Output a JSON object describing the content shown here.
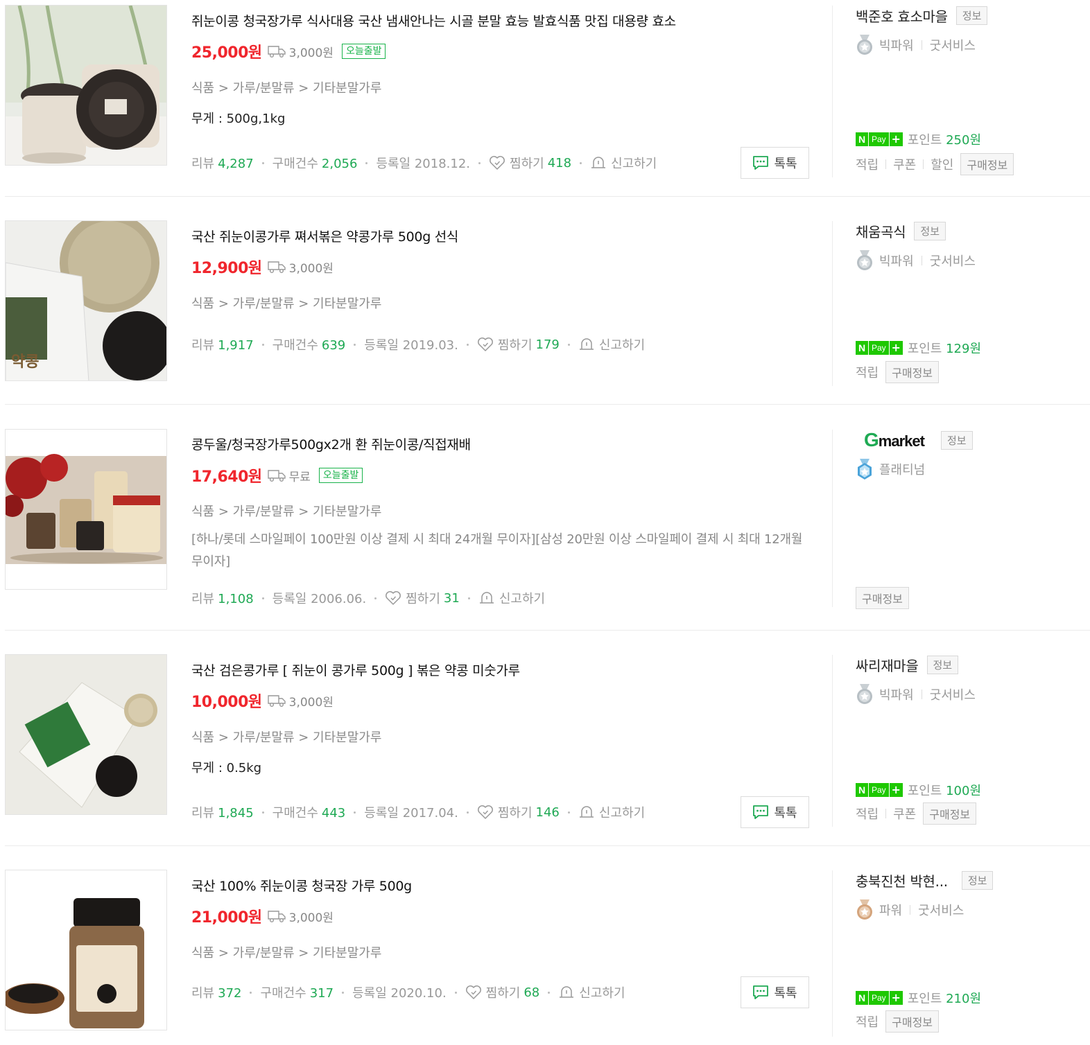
{
  "icons": {
    "truck": "truck-icon",
    "heart": "heart-icon",
    "bell": "report-bell-icon",
    "talk": "talk-bubble-icon",
    "medal": "grade-medal-icon"
  },
  "colors": {
    "price": "#f0262d",
    "accent_green": "#1fa954",
    "npay_green": "#1ec800",
    "badge_green": "#19b34a"
  },
  "labels": {
    "review": "리뷰",
    "purchase": "구매건수",
    "registered": "등록일",
    "wish": "찜하기",
    "report": "신고하기",
    "talk": "톡톡",
    "info": "정보",
    "point": "포인트",
    "buy_info": "구매정보",
    "npay_n": "N",
    "npay_pay": "Pay",
    "npay_plus": "+"
  },
  "products": [
    {
      "title": "쥐눈이콩 청국장가루 식사대용 국산 냄새안나는 시골 분말 효능 발효식품 맛집 대용량 효소",
      "price": "25,000원",
      "shipping": "3,000원",
      "badge": "오늘출발",
      "category": "식품 > 가루/분말류 > 기타분말가루",
      "spec": "무게 : 500g,1kg",
      "review": "4,287",
      "purchase": "2,056",
      "registered": "2018.12.",
      "wish": "418",
      "seller": "백준호 효소마을",
      "grade": "빅파워",
      "service": "굿서비스",
      "point_amount": "250원",
      "benefits": [
        "적립",
        "쿠폰",
        "할인"
      ]
    },
    {
      "title": "국산 쥐눈이콩가루 쪄서볶은 약콩가루 500g 선식",
      "price": "12,900원",
      "shipping": "3,000원",
      "category": "식품 > 가루/분말류 > 기타분말가루",
      "review": "1,917",
      "purchase": "639",
      "registered": "2019.03.",
      "wish": "179",
      "seller": "채움곡식",
      "grade": "빅파워",
      "service": "굿서비스",
      "point_amount": "129원",
      "benefits": [
        "적립"
      ]
    },
    {
      "title": "콩두울/청국장가루500gx2개 환 쥐눈이콩/직접재배",
      "price": "17,640원",
      "shipping": "무료",
      "badge": "오늘출발",
      "category": "식품 > 가루/분말류 > 기타분말가루",
      "desc": "[하나/롯데 스마일페이 100만원 이상 결제 시 최대 24개월 무이자][삼성 20만원 이상 스마일페이 결제 시 최대 12개월 무이자]",
      "review": "1,108",
      "registered": "2006.06.",
      "wish": "31",
      "seller_logo_g": "G",
      "seller_logo_rest": "market",
      "grade": "플래티넘"
    },
    {
      "title": "국산 검은콩가루 [ 쥐눈이 콩가루 500g ] 볶은 약콩 미숫가루",
      "price": "10,000원",
      "shipping": "3,000원",
      "category": "식품 > 가루/분말류 > 기타분말가루",
      "spec": "무게 : 0.5kg",
      "review": "1,845",
      "purchase": "443",
      "registered": "2017.04.",
      "wish": "146",
      "seller": "싸리재마을",
      "grade": "빅파워",
      "service": "굿서비스",
      "point_amount": "100원",
      "benefits": [
        "적립",
        "쿠폰"
      ]
    },
    {
      "title": "국산 100% 쥐눈이콩 청국장 가루 500g",
      "price": "21,000원",
      "shipping": "3,000원",
      "category": "식품 > 가루/분말류 > 기타분말가루",
      "review": "372",
      "purchase": "317",
      "registered": "2020.10.",
      "wish": "68",
      "seller": "충북진천 박현...",
      "grade": "파워",
      "service": "굿서비스",
      "point_amount": "210원",
      "benefits": [
        "적립"
      ]
    }
  ]
}
